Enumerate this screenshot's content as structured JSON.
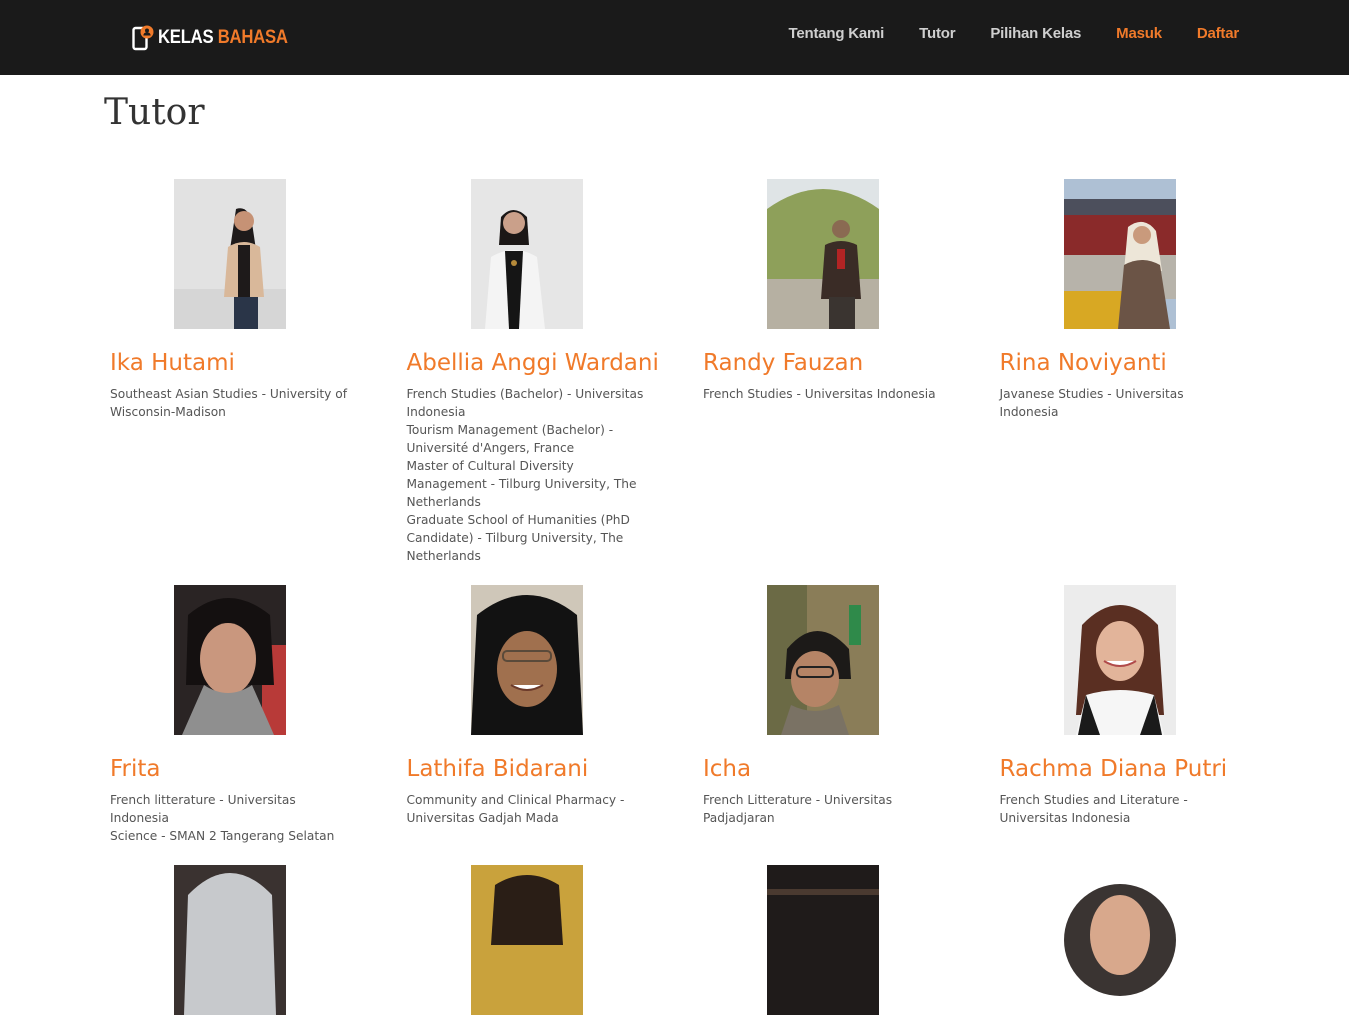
{
  "brand": {
    "word1": "KELAS",
    "word2": "BAHASA"
  },
  "nav": {
    "items": [
      {
        "label": "Tentang Kami"
      },
      {
        "label": "Tutor"
      },
      {
        "label": "Pilihan Kelas"
      },
      {
        "label": "Masuk"
      },
      {
        "label": "Daftar"
      }
    ]
  },
  "page": {
    "title": "Tutor"
  },
  "tutors": [
    {
      "name": "Ika Hutami",
      "lines": [
        "Southeast Asian Studies - University of Wisconsin-Madison"
      ]
    },
    {
      "name": "Abellia Anggi Wardani",
      "lines": [
        "French Studies (Bachelor) - Universitas Indonesia",
        "Tourism Management (Bachelor) - Université d'Angers, France",
        "Master of Cultural Diversity Management - Tilburg University, The Netherlands",
        "Graduate School of Humanities (PhD Candidate) - Tilburg University, The Netherlands"
      ]
    },
    {
      "name": "Randy Fauzan",
      "lines": [
        "French Studies - Universitas Indonesia"
      ]
    },
    {
      "name": "Rina Noviyanti",
      "lines": [
        "Javanese Studies - Universitas Indonesia"
      ]
    },
    {
      "name": "Frita",
      "lines": [
        "French litterature - Universitas Indonesia",
        "Science - SMAN 2 Tangerang Selatan"
      ]
    },
    {
      "name": "Lathifa Bidarani",
      "lines": [
        "Community and Clinical Pharmacy - Universitas Gadjah Mada"
      ]
    },
    {
      "name": "Icha",
      "lines": [
        "French Litterature - Universitas Padjadjaran"
      ]
    },
    {
      "name": "Rachma Diana Putri",
      "lines": [
        "French Studies and Literature - Universitas Indonesia"
      ]
    }
  ],
  "colors": {
    "accent": "#f07a2a",
    "navbar": "#1a1a1a",
    "nav_text": "#cfcfcf"
  }
}
